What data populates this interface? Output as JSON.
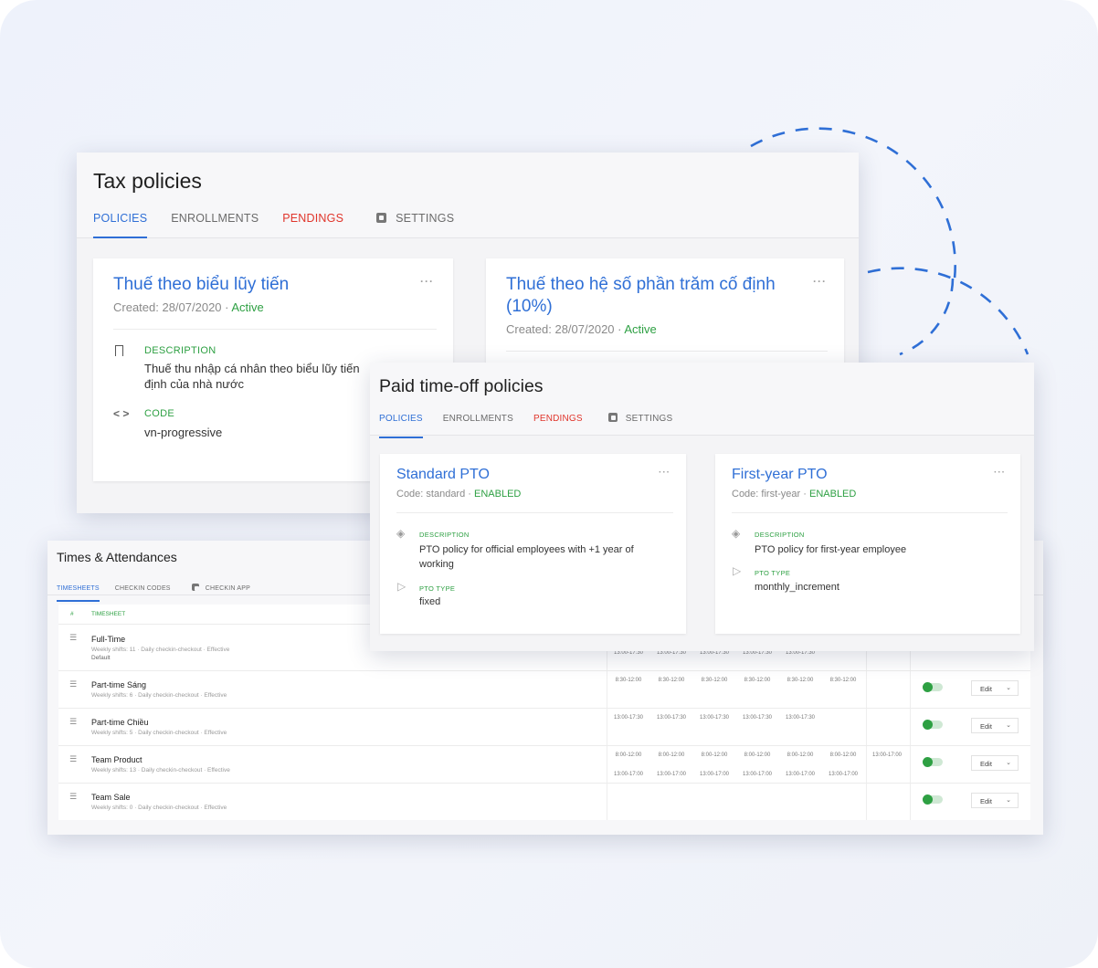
{
  "tax": {
    "title": "Tax policies",
    "tabs": [
      "POLICIES",
      "ENROLLMENTS",
      "PENDINGS",
      "SETTINGS"
    ],
    "cards": [
      {
        "title": "Thuế theo biểu lũy tiến",
        "created": "Created: 28/07/2020 ·",
        "status": "Active",
        "description_label": "DESCRIPTION",
        "description": "Thuế thu nhập cá nhân theo biểu lũy tiến",
        "description_line2": "định của nhà nước",
        "code_label": "CODE",
        "code": "vn-progressive"
      },
      {
        "title_line1": "Thuế theo hệ số phần trăm cố định",
        "title_line2": "(10%)",
        "created": "Created: 28/07/2020 ·",
        "status": "Active"
      }
    ]
  },
  "pto": {
    "title": "Paid time-off policies",
    "tabs": [
      "POLICIES",
      "ENROLLMENTS",
      "PENDINGS",
      "SETTINGS"
    ],
    "cards": [
      {
        "title": "Standard PTO",
        "code": "Code: standard ·",
        "status": "ENABLED",
        "description_label": "DESCRIPTION",
        "description_line1": "PTO policy for official employees with +1 year of",
        "description_line2": "working",
        "type_label": "PTO TYPE",
        "type": "fixed"
      },
      {
        "title": "First-year PTO",
        "code": "Code: first-year ·",
        "status": "ENABLED",
        "description_label": "DESCRIPTION",
        "description_line1": "PTO policy for first-year employee",
        "type_label": "PTO TYPE",
        "type": "monthly_increment"
      }
    ]
  },
  "times": {
    "title": "Times & Attendances",
    "tabs": [
      "TIMESHEETS",
      "CHECKIN CODES",
      "CHECKIN APP"
    ],
    "table_header": {
      "hash": "#",
      "timesheet": "TIMESHEET"
    },
    "edit_label": "Edit",
    "rows": [
      {
        "name": "Full-Time",
        "sub": "Weekly shifts: 11 · Daily checkin-checkout · Effective",
        "sub2": "Default",
        "shifts": [
          "13:00-17:30",
          "13:00-17:30",
          "13:00-17:30",
          "13:00-17:30",
          "13:00-17:30"
        ]
      },
      {
        "name": "Part-time Sáng",
        "sub": "Weekly shifts: 6 · Daily checkin-checkout · Effective",
        "shifts": [
          "8:30-12:00",
          "8:30-12:00",
          "8:30-12:00",
          "8:30-12:00",
          "8:30-12:00",
          "8:30-12:00"
        ]
      },
      {
        "name": "Part-time Chiều",
        "sub": "Weekly shifts: 5 · Daily checkin-checkout · Effective",
        "shifts": [
          "13:00-17:30",
          "13:00-17:30",
          "13:00-17:30",
          "13:00-17:30",
          "13:00-17:30"
        ]
      },
      {
        "name": "Team Product",
        "sub": "Weekly shifts: 13 · Daily checkin-checkout · Effective",
        "shifts": [
          "8:00-12:00",
          "8:00-12:00",
          "8:00-12:00",
          "8:00-12:00",
          "8:00-12:00",
          "8:00-12:00",
          "13:00-17:00"
        ],
        "shifts2": [
          "13:00-17:00",
          "13:00-17:00",
          "13:00-17:00",
          "13:00-17:00",
          "13:00-17:00",
          "13:00-17:00"
        ]
      },
      {
        "name": "Team Sale",
        "sub": "Weekly shifts: 0 · Daily checkin-checkout · Effective",
        "shifts": []
      }
    ]
  },
  "colors": {
    "accent": "#2f6fd6",
    "success": "#2ea043",
    "danger": "#e0352b"
  },
  "icons": [
    "bookmark-icon",
    "code-icon",
    "settings-icon",
    "layers-icon",
    "play-icon",
    "drag-handle-icon",
    "chevron-down-icon",
    "more-icon"
  ]
}
